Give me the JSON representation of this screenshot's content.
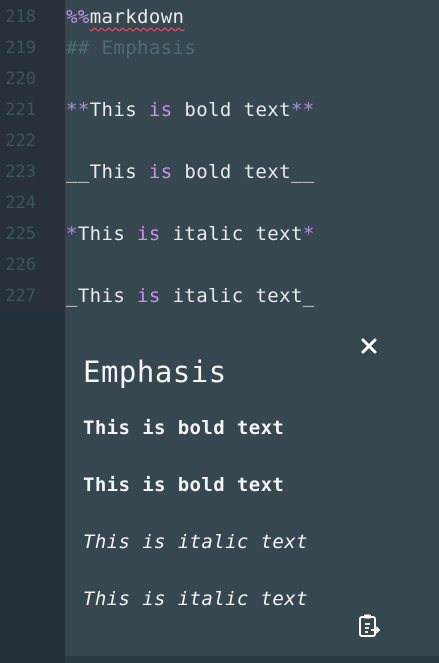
{
  "editor": {
    "lines": [
      {
        "num": "218",
        "parts": [
          {
            "t": "%%",
            "c": "magic"
          },
          {
            "t": "markdown",
            "c": "squig"
          }
        ]
      },
      {
        "num": "219",
        "parts": [
          {
            "t": "## Emphasis",
            "c": "dim"
          }
        ]
      },
      {
        "num": "220",
        "parts": []
      },
      {
        "num": "221",
        "parts": [
          {
            "t": "**",
            "c": "mk"
          },
          {
            "t": "This ",
            "c": ""
          },
          {
            "t": "is",
            "c": "kw"
          },
          {
            "t": " bold text",
            "c": ""
          },
          {
            "t": "**",
            "c": "mk"
          }
        ]
      },
      {
        "num": "222",
        "parts": []
      },
      {
        "num": "223",
        "parts": [
          {
            "t": "__This ",
            "c": ""
          },
          {
            "t": "is",
            "c": "kw"
          },
          {
            "t": " bold text__",
            "c": ""
          }
        ]
      },
      {
        "num": "224",
        "parts": []
      },
      {
        "num": "225",
        "parts": [
          {
            "t": "*",
            "c": "mk"
          },
          {
            "t": "This ",
            "c": ""
          },
          {
            "t": "is",
            "c": "kw"
          },
          {
            "t": " italic text",
            "c": ""
          },
          {
            "t": "*",
            "c": "mk"
          }
        ]
      },
      {
        "num": "226",
        "parts": []
      },
      {
        "num": "227",
        "parts": [
          {
            "t": "_This ",
            "c": ""
          },
          {
            "t": "is",
            "c": "kw"
          },
          {
            "t": " italic text_",
            "c": ""
          }
        ]
      }
    ]
  },
  "preview": {
    "heading": "Emphasis",
    "bold_1": "This is bold text",
    "bold_2": "This is bold text",
    "italic_1": "This is italic text",
    "italic_2": "This is italic text",
    "close_icon": "close-icon",
    "copy_icon": "clipboard-copy-icon"
  },
  "colors": {
    "background": "#2b3a40",
    "editor_bg": "#37474f",
    "gutter_bg": "#263238",
    "keyword": "#c792ea",
    "comment": "#4f6a74",
    "text": "#e7ebed",
    "squiggle": "#ff5370"
  }
}
